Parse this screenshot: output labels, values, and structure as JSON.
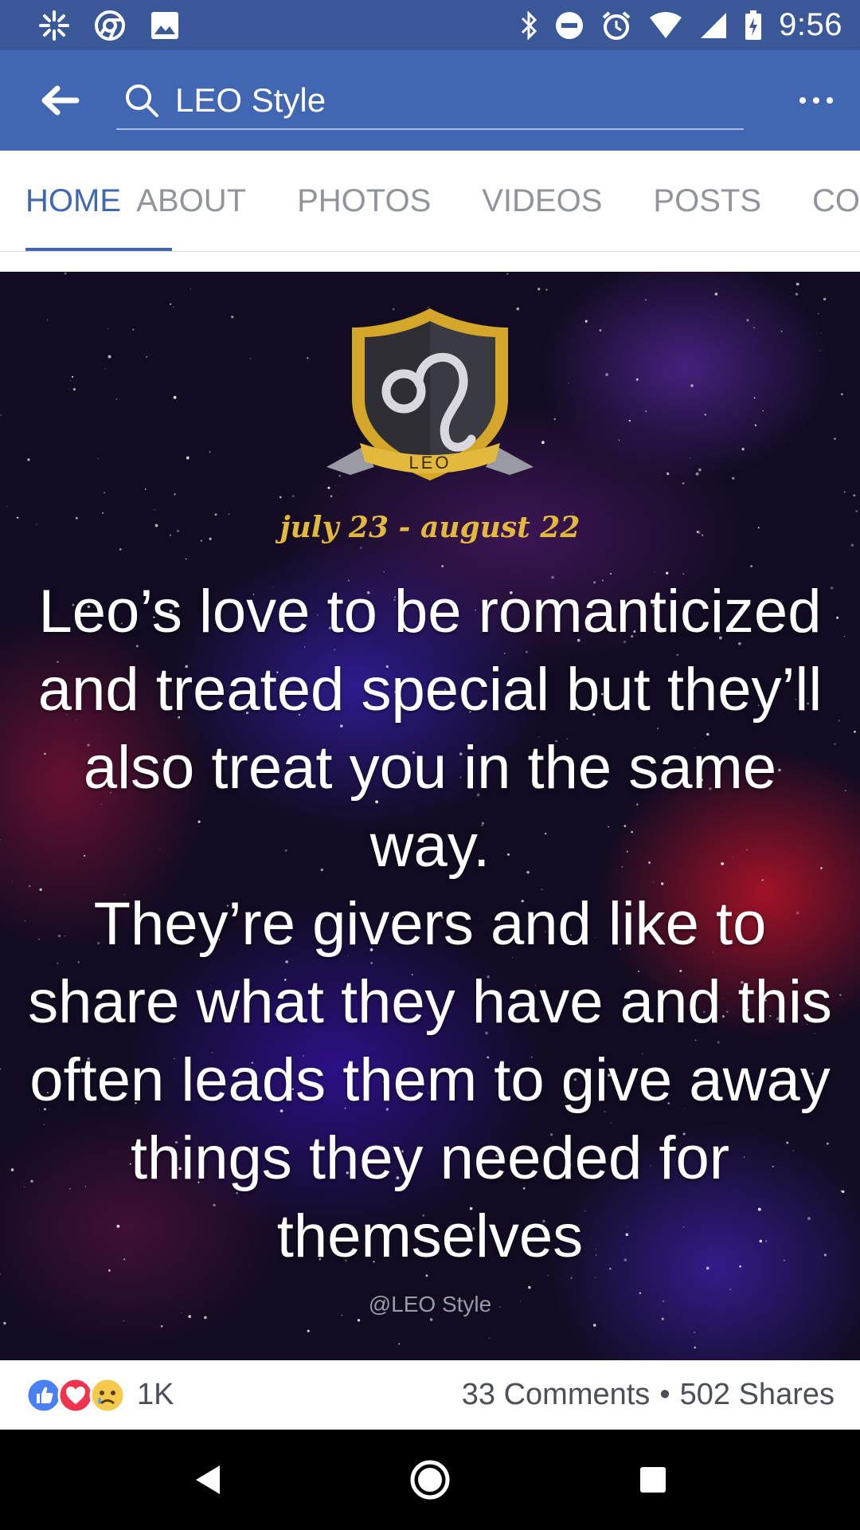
{
  "status_bar": {
    "time": "9:56",
    "left_icons": [
      "pinwheel-icon",
      "chrome-icon",
      "image-icon"
    ],
    "right_icons": [
      "bluetooth-icon",
      "do-not-disturb-icon",
      "alarm-icon",
      "wifi-icon",
      "signal-icon",
      "battery-icon"
    ]
  },
  "app_bar": {
    "search_text": "LEO Style",
    "background": "#4267b2"
  },
  "tabs": [
    {
      "label": "HOME",
      "active": true
    },
    {
      "label": "ABOUT",
      "active": false
    },
    {
      "label": "PHOTOS",
      "active": false
    },
    {
      "label": "VIDEOS",
      "active": false
    },
    {
      "label": "POSTS",
      "active": false
    },
    {
      "label": "CO",
      "active": false
    }
  ],
  "post": {
    "crest_label": "LEO",
    "date_range": "july 23 - august 22",
    "quote_lines": [
      "Leo’s love to be romanticized",
      "and treated special but they’ll",
      "also treat you in the same",
      "way.",
      "They’re givers and like to",
      "share what they have and this",
      "often leads them to give away",
      "things they needed for",
      "themselves"
    ],
    "watermark": "@LEO Style"
  },
  "reactions": {
    "icons": [
      "like-icon",
      "love-icon",
      "sad-icon"
    ],
    "count": "1K",
    "comments": "33 Comments",
    "separator": "•",
    "shares": "502 Shares"
  },
  "colors": {
    "status_bar": "#3b5998",
    "accent": "#4267b2",
    "inactive_tab": "#90949c",
    "gold": "#e2b93c"
  }
}
